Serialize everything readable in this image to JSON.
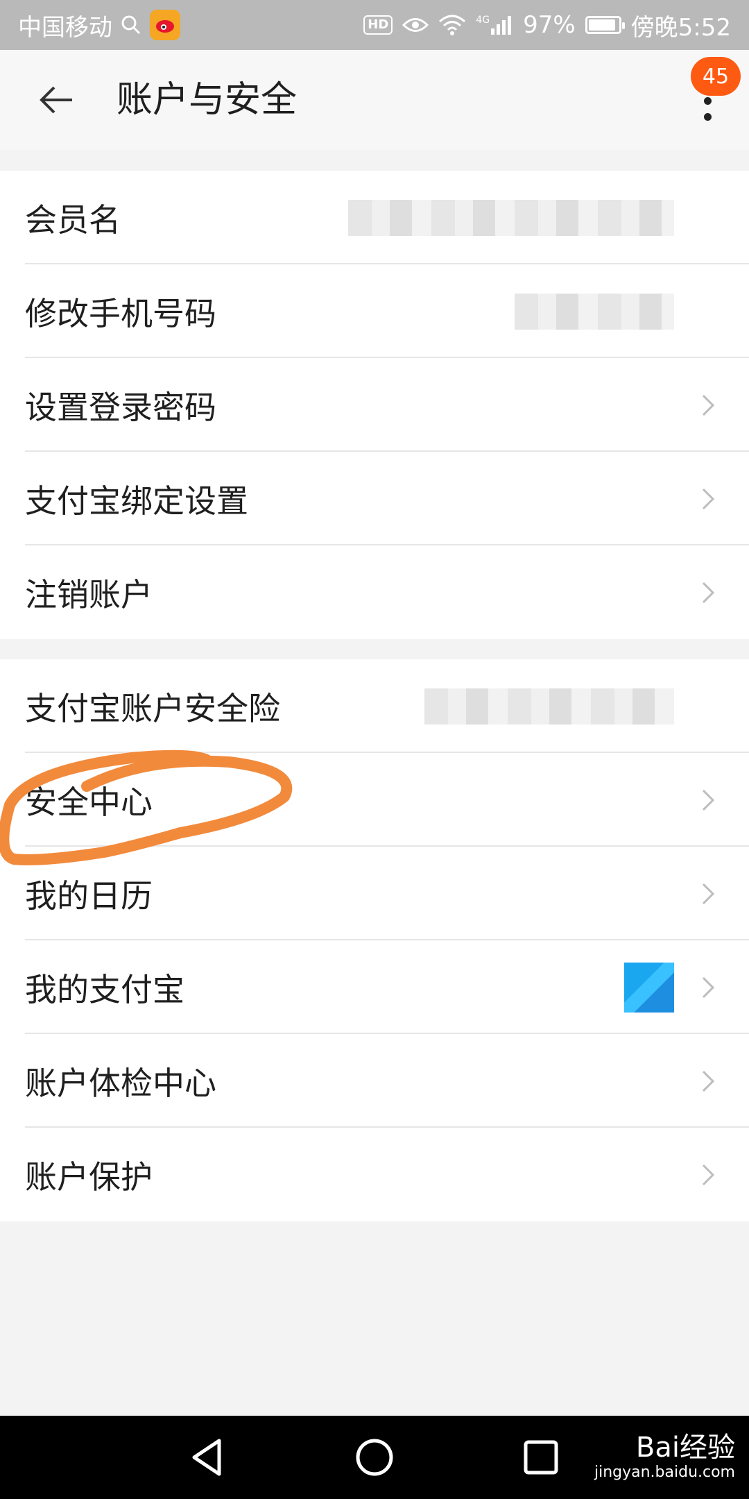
{
  "status_bar": {
    "carrier": "中国移动",
    "battery": "97%",
    "battery_level": 0.97,
    "time": "傍晚5:52",
    "network": "4G",
    "hd_label": "HD",
    "icons": [
      "search-icon",
      "weibo-icon",
      "hd-icon",
      "eye-icon",
      "wifi-icon",
      "signal-icon",
      "battery-icon"
    ]
  },
  "header": {
    "title": "账户与安全",
    "badge_count": "45",
    "icons": [
      "back-arrow-icon",
      "more-vertical-icon"
    ]
  },
  "group1": [
    {
      "label": "会员名",
      "value": "(blurred)"
    },
    {
      "label": "修改手机号码",
      "value": "(blurred)"
    },
    {
      "label": "设置登录密码"
    },
    {
      "label": "支付宝绑定设置"
    },
    {
      "label": "注销账户"
    }
  ],
  "group2": [
    {
      "label": "支付宝账户安全险",
      "value": "(blurred)"
    },
    {
      "label": "安全中心"
    },
    {
      "label": "我的日历"
    },
    {
      "label": "我的支付宝"
    },
    {
      "label": "账户体检中心"
    },
    {
      "label": "账户保护"
    }
  ],
  "annotation_color": "#f28a3c",
  "accent_color": "#ff5a12",
  "watermark": {
    "brand": "Bai经验",
    "url": "jingyan.baidu.com"
  },
  "nav_icons": [
    "nav-back-icon",
    "nav-home-icon",
    "nav-recent-icon"
  ]
}
